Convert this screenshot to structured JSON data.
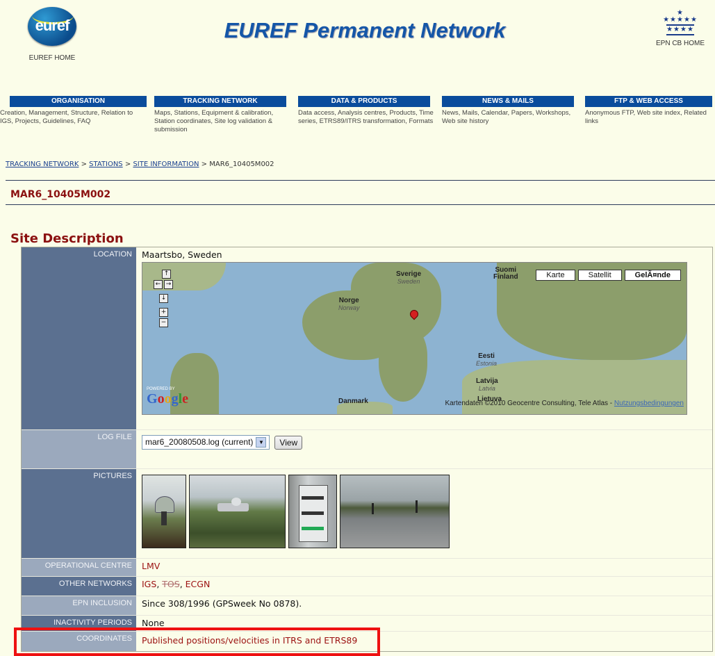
{
  "header": {
    "logo_text": "euref",
    "home_label": "EUREF HOME",
    "title": "EUREF Permanent Network",
    "cb_home_label": "EPN CB HOME"
  },
  "nav": [
    {
      "tab": "ORGANISATION",
      "desc": "Creation, Management, Structure, Relation to IGS, Projects, Guidelines, FAQ"
    },
    {
      "tab": "TRACKING NETWORK",
      "desc": "Maps, Stations, Equipment & calibration, Station coordinates, Site log validation & submission"
    },
    {
      "tab": "DATA & PRODUCTS",
      "desc": "Data access, Analysis centres, Products, Time series, ETRS89/ITRS transformation, Formats"
    },
    {
      "tab": "NEWS & MAILS",
      "desc": "News, Mails, Calendar, Papers, Workshops, Web site history"
    },
    {
      "tab": "FTP & WEB ACCESS",
      "desc": "Anonymous FTP, Web site index, Related links"
    }
  ],
  "breadcrumb": {
    "items": [
      "TRACKING NETWORK",
      "STATIONS",
      "SITE INFORMATION"
    ],
    "separator": ">",
    "current": "MAR6_10405M002"
  },
  "station_name": "MAR6_10405M002",
  "section_title": "Site Description",
  "rows": {
    "location": {
      "label": "LOCATION",
      "value": "Maartsbo, Sweden"
    },
    "log_file": {
      "label": "LOG FILE",
      "selected": "mar6_20080508.log (current)",
      "button": "View"
    },
    "pictures": {
      "label": "PICTURES"
    },
    "operational_centre": {
      "label": "OPERATIONAL CENTRE",
      "value": "LMV"
    },
    "other_networks": {
      "label": "OTHER NETWORKS",
      "n1": "IGS",
      "sep": ", ",
      "n2": "TOS",
      "sep2": ", ",
      "n3": "ECGN"
    },
    "epn_inclusion": {
      "label": "EPN INCLUSION",
      "value": "Since 308/1996 (GPSweek No 0878)."
    },
    "inactivity": {
      "label": "INACTIVITY PERIODS",
      "value": "None"
    },
    "coordinates": {
      "label": "COORDINATES",
      "value": "Published positions/velocities in ITRS and ETRS89"
    }
  },
  "map": {
    "types": [
      "Karte",
      "Satellit",
      "GelÃ¤nde"
    ],
    "controls": {
      "up": "↑",
      "left": "←",
      "right": "→",
      "down": "↓",
      "zoom_in": "+",
      "zoom_out": "−"
    },
    "labels": {
      "sverige": "Sverige",
      "sverige_en": "Sweden",
      "suomi": "Suomi",
      "finland": "Finland",
      "norge": "Norge",
      "norway": "Norway",
      "eesti": "Eesti",
      "estonia": "Estonia",
      "latvija": "Latvija",
      "latvia": "Latvia",
      "lietuva": "Lietuva",
      "danmark": "Danmark"
    },
    "powered_by": "POWERED BY",
    "google": "Google",
    "copyright": "Kartendaten ©2010 Geocentre Consulting, Tele Atlas - ",
    "terms": "Nutzungsbedingungen"
  },
  "colors": {
    "accent": "#0a4c9c",
    "station": "#8b1010",
    "highlight": "#ee1111"
  }
}
